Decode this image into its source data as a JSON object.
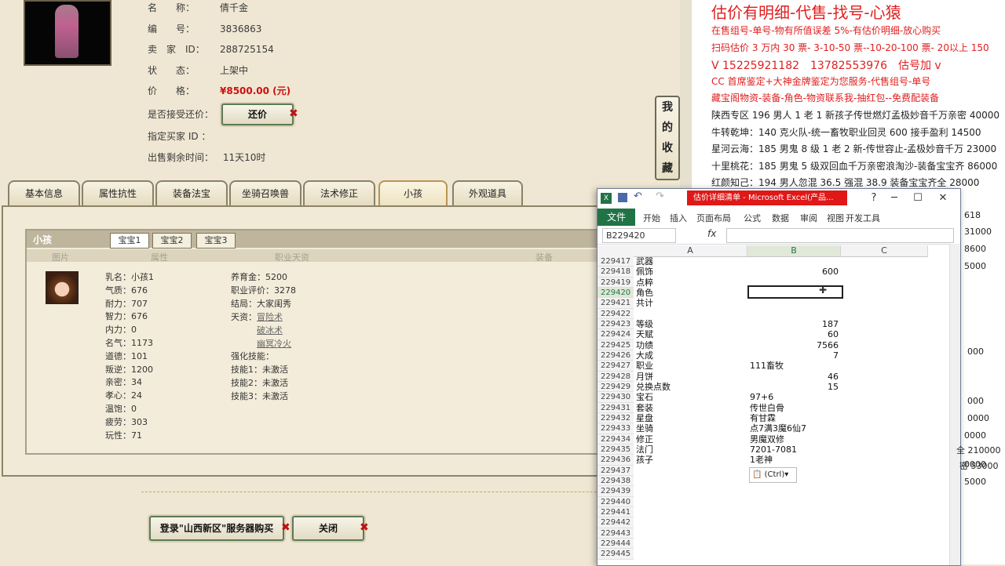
{
  "game": {
    "info": [
      {
        "key": "名　　称：",
        "value": "倩千金"
      },
      {
        "key": "编　　号：",
        "value": "3836863"
      },
      {
        "key": "卖　家　ID：",
        "value": "288725154"
      },
      {
        "key": "状　　态：",
        "value": "上架中"
      },
      {
        "key": "价　　格：",
        "value": "¥8500.00 (元)"
      }
    ],
    "accept_bargain_label": "是否接受还价：",
    "bargain_button": "还价",
    "buyer_id_label": "指定买家 ID ：",
    "remaining_label": "出售剩余时间：",
    "remaining_value": "11天10时",
    "favorites": "我的收藏",
    "tabs": [
      "基本信息",
      "属性抗性",
      "装备法宝",
      "坐骑召唤兽",
      "法术修正",
      "小孩",
      "外观道具"
    ],
    "section_title": "小孩",
    "subtabs": [
      "宝宝1",
      "宝宝2",
      "宝宝3"
    ],
    "columns": [
      "图片",
      "属性",
      "职业天资",
      "装备"
    ],
    "attrs_left": [
      "乳名：小孩1",
      "气质：676",
      "耐力：707",
      "智力：676",
      "内力：0",
      "名气：1173",
      "道德：101",
      "叛逆：1200",
      "亲密：34",
      "孝心：24",
      "温饱：0",
      "疲劳：303",
      "玩性：71"
    ],
    "attrs_right": [
      "养育金：5200",
      "职业评价：3278",
      "结局：大家闺秀",
      "天资：",
      "强化技能：",
      "技能1：未激活",
      "技能2：未激活",
      "技能3：未激活"
    ],
    "talents": [
      "冒险术",
      "破冰术",
      "幽冥冷火"
    ],
    "login_button": "登录\"山西新区\"服务器购买",
    "close_button": "关闭"
  },
  "right": {
    "title": "估价有明细-代售-找号-心猿",
    "red_lines": [
      "在售组号-单号-物有所值误差 5%-有估价明细-放心购买",
      "扫码估价 3 万内 30 票- 3-10-50 票--10-20-100 票- 20以上 150",
      "V 15225921182　13782553976　估号加 v",
      "CC 首席鉴定+大神金牌鉴定为您服务-代售组号-单号",
      "藏宝阁物资-装备-角色-物资联系我-抽红包--免费配装备"
    ],
    "black_lines": [
      "陕西专区 196 男人 1 老 1 新孩子传世燃灯孟极妙音千万亲密 40000",
      "牛转乾坤：140 克火队-统一畜牧职业回灵 600 接手盈利 14500",
      "星河云海：185 男鬼 8 级 1 老 2 新-传世容止-孟极妙音千万 23000",
      "十里桃花：185 男鬼 5 级双回血千万亲密浪淘沙-装备宝宝齐 86000",
      "红颜知己：194 男人忽混 36.5 强混 38.9 装备宝宝齐全 28000"
    ],
    "fragments": [
      "618",
      "31000",
      "8600",
      "5000",
      "000",
      "000",
      "0000",
      "0000",
      "0000",
      "全 210000",
      "密 53000",
      "5000"
    ]
  },
  "excel": {
    "caption": "估价详细清单 - Microsoft Excel(产品...",
    "ribbon": {
      "file": "文件",
      "tabs": [
        "开始",
        "插入",
        "页面布局",
        "公式",
        "数据",
        "审阅",
        "视图",
        "开发工具"
      ]
    },
    "namebox": "B229420",
    "fx": "fx",
    "columns": [
      "A",
      "B",
      "C"
    ],
    "rows": [
      {
        "r": "229417",
        "a": "武器",
        "b": ""
      },
      {
        "r": "229418",
        "a": "佩饰",
        "b": "600"
      },
      {
        "r": "229419",
        "a": "点粹",
        "b": ""
      },
      {
        "r": "229420",
        "a": "角色",
        "b": ""
      },
      {
        "r": "229421",
        "a": "共计",
        "b": ""
      },
      {
        "r": "229422",
        "a": "",
        "b": ""
      },
      {
        "r": "229423",
        "a": "等级",
        "b": "187"
      },
      {
        "r": "229424",
        "a": "天赋",
        "b": "60"
      },
      {
        "r": "229425",
        "a": "功绩",
        "b": "7566"
      },
      {
        "r": "229426",
        "a": "大成",
        "b": "7"
      },
      {
        "r": "229427",
        "a": "职业",
        "b": "111畜牧"
      },
      {
        "r": "229428",
        "a": "月饼",
        "b": "46"
      },
      {
        "r": "229429",
        "a": "兑换点数",
        "b": "15"
      },
      {
        "r": "229430",
        "a": "宝石",
        "b": "97+6"
      },
      {
        "r": "229431",
        "a": "套装",
        "b": "传世白骨"
      },
      {
        "r": "229432",
        "a": "星盘",
        "b": "有甘霖"
      },
      {
        "r": "229433",
        "a": "坐骑",
        "b": "点7满3魔6仙7"
      },
      {
        "r": "229434",
        "a": "修正",
        "b": "男魔双修"
      },
      {
        "r": "229435",
        "a": "法门",
        "b": "7201-7081"
      },
      {
        "r": "229436",
        "a": "孩子",
        "b": "1老神"
      },
      {
        "r": "229437",
        "a": "",
        "b": ""
      },
      {
        "r": "229438",
        "a": "",
        "b": ""
      },
      {
        "r": "229439",
        "a": "",
        "b": ""
      },
      {
        "r": "229440",
        "a": "",
        "b": ""
      },
      {
        "r": "229441",
        "a": "",
        "b": ""
      },
      {
        "r": "229442",
        "a": "",
        "b": ""
      },
      {
        "r": "229443",
        "a": "",
        "b": ""
      },
      {
        "r": "229444",
        "a": "",
        "b": ""
      },
      {
        "r": "229445",
        "a": "",
        "b": ""
      }
    ],
    "paste_options": "(Ctrl)"
  }
}
